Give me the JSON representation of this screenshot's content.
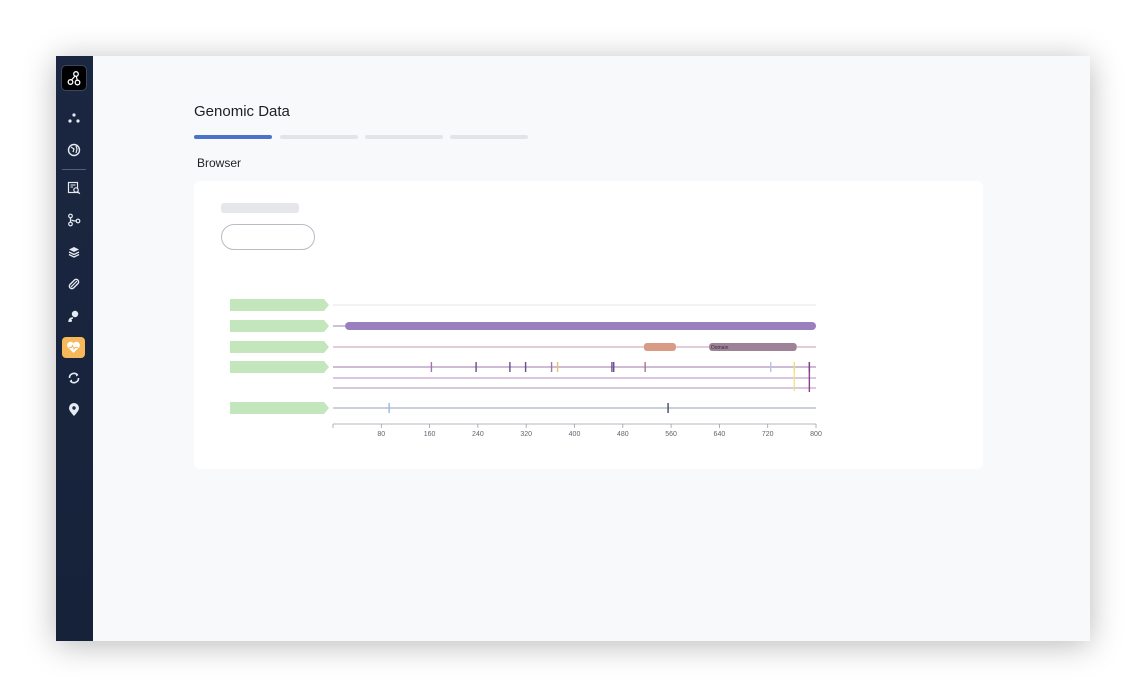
{
  "page": {
    "title": "Genomic Data",
    "section_label": "Browser"
  },
  "colors": {
    "sidebar_bg": "#1b2740",
    "accent": "#4b72cc",
    "active_nav": "#f6b858",
    "track_label": "#c3e6bd",
    "protein_bar": "#9a7fbf",
    "domain_orange": "#d99b86",
    "domain_purple": "#9e8298"
  },
  "sidebar": {
    "items": [
      {
        "icon": "dots-icon"
      },
      {
        "icon": "globe-icon"
      },
      {
        "icon": "search-document-icon"
      },
      {
        "icon": "branch-icon"
      },
      {
        "icon": "layers-icon"
      },
      {
        "icon": "pill-icon"
      },
      {
        "icon": "user-icon"
      },
      {
        "icon": "heart-icon",
        "active": true
      },
      {
        "icon": "sync-icon"
      },
      {
        "icon": "location-pin-icon"
      }
    ]
  },
  "steps": [
    {
      "active": true
    },
    {
      "active": false
    },
    {
      "active": false
    },
    {
      "active": false
    }
  ],
  "chart_data": {
    "type": "genome-browser",
    "xlim": [
      0,
      800
    ],
    "ticks": [
      80,
      160,
      240,
      320,
      400,
      480,
      560,
      640,
      720,
      800
    ],
    "tracks": [
      {
        "kind": "line",
        "color": "#e4d6df"
      },
      {
        "kind": "bar",
        "color": "#9a7fbf",
        "start": 20,
        "end": 800
      },
      {
        "kind": "domains",
        "color": "#c59bb3",
        "domains": [
          {
            "start": 515,
            "end": 568,
            "color": "#d99b86",
            "label": ""
          },
          {
            "start": 623,
            "end": 768,
            "color": "#9e8298",
            "label": "Domain"
          }
        ]
      },
      {
        "kind": "sites",
        "color": "#9d77a8",
        "sites": [
          {
            "x": 163,
            "color": "#9d77a8"
          },
          {
            "x": 237,
            "color": "#6a4c8a"
          },
          {
            "x": 293,
            "color": "#6a4c8a"
          },
          {
            "x": 319,
            "color": "#6a4c8a"
          },
          {
            "x": 362,
            "color": "#9d77a8"
          },
          {
            "x": 372,
            "color": "#e8c36a"
          },
          {
            "x": 462,
            "color": "#6a4c8a"
          },
          {
            "x": 465,
            "color": "#6a4c8a"
          },
          {
            "x": 517,
            "color": "#b07090"
          },
          {
            "x": 725,
            "color": "#b7c4de"
          },
          {
            "x": 764,
            "color": "#f0df7a"
          },
          {
            "x": 789,
            "color": "#8a3f8a"
          }
        ]
      },
      {
        "kind": "line",
        "color": "#b391c1"
      },
      {
        "kind": "line",
        "color": "#b391c1"
      },
      {
        "kind": "sites",
        "color": "#98a0b0",
        "sites": [
          {
            "x": 93,
            "color": "#9ab8de"
          },
          {
            "x": 555,
            "color": "#444c5c"
          }
        ]
      }
    ]
  }
}
